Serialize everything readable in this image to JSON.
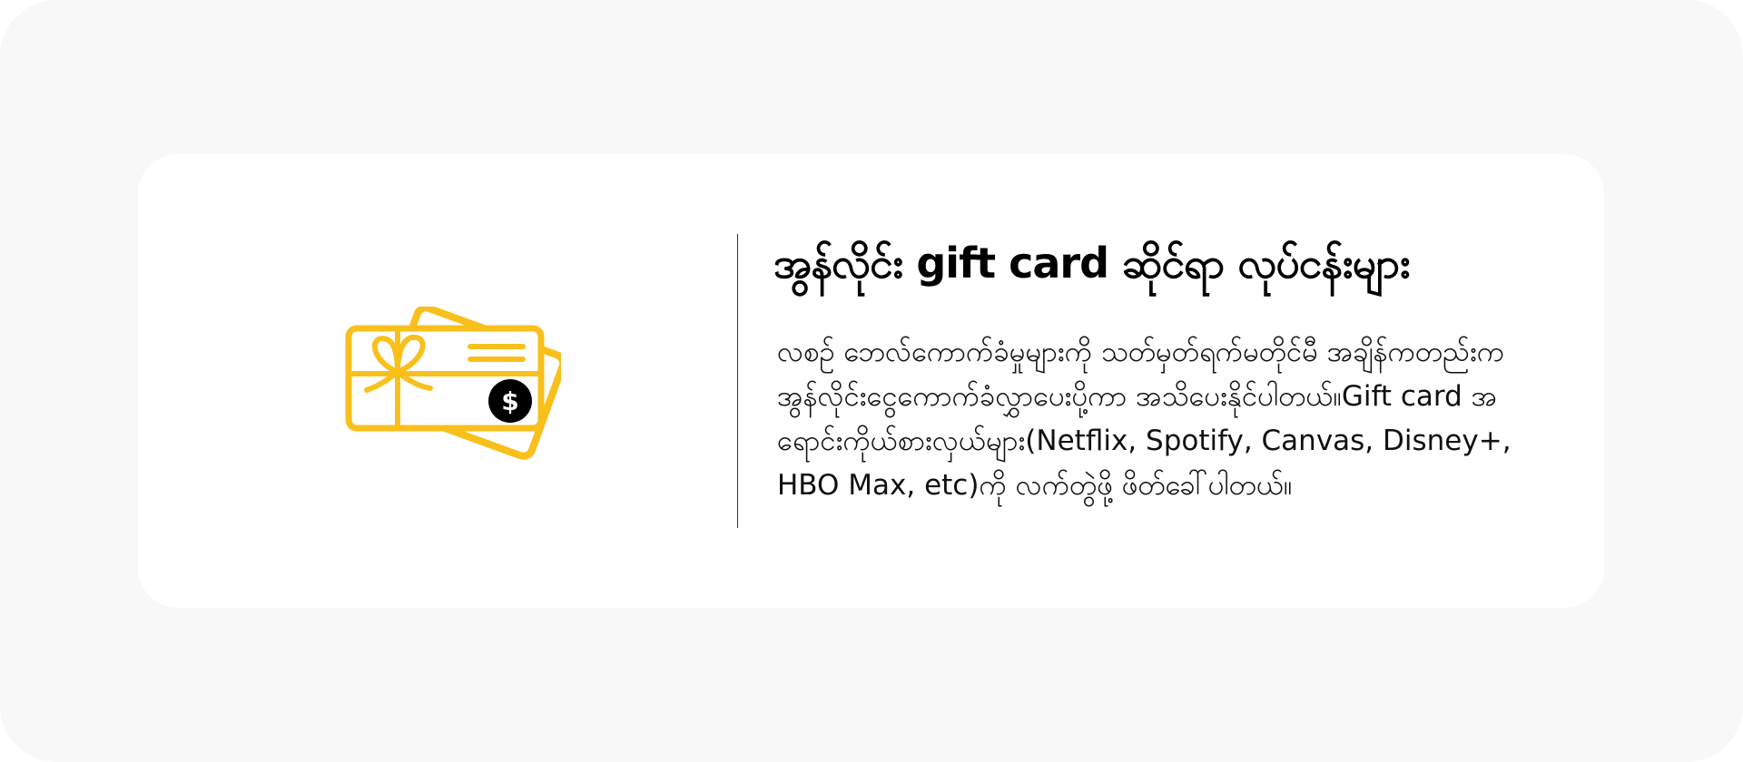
{
  "feature": {
    "title": "အွန်လိုင်း gift card ဆိုင်ရာ လုပ်ငန်းများ",
    "description": "လစဉ် ဘေလ်ကောက်ခံမှုများကို သတ်မှတ်ရက်မတိုင်မီ အချိန်ကတည်းက အွန်လိုင်းငွေကောက်ခံလွှာပေးပို့ကာ အသိပေးနိုင်ပါတယ်။Gift card အရောင်းကိုယ်စားလှယ်များ(Netflix, Spotify, Canvas, Disney+, HBO Max, etc)ကို လက်တွဲဖို့ ဖိတ်ခေါ်ပါတယ်။",
    "icon": "gift-card-icon",
    "dollar_symbol": "$",
    "colors": {
      "accent": "#F9C01C",
      "badge": "#000000",
      "page_background": "#F8F8F8",
      "card_background": "#FFFFFF"
    }
  }
}
